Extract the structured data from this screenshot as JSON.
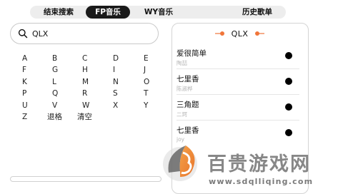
{
  "tabs": [
    {
      "label": "结束搜索"
    },
    {
      "label": "FP音乐",
      "active": true
    },
    {
      "label": "WY音乐"
    },
    {
      "label": "历史歌单"
    }
  ],
  "search": {
    "value": "QLX",
    "icon": "search-icon"
  },
  "keyboard": {
    "rows": [
      [
        "A",
        "B",
        "C",
        "D",
        "E"
      ],
      [
        "F",
        "G",
        "H",
        "I",
        "J"
      ],
      [
        "K",
        "L",
        "M",
        "N",
        "O"
      ],
      [
        "P",
        "Q",
        "R",
        "S",
        "T"
      ],
      [
        "U",
        "V",
        "W",
        "X",
        "Y"
      ],
      [
        "Z",
        "退格",
        "清空"
      ]
    ]
  },
  "panel": {
    "title": "QLX",
    "songs": [
      {
        "title": "爱很简单",
        "artist": "陶喆"
      },
      {
        "title": "七里香",
        "artist": "陈淑桦"
      },
      {
        "title": "三角题",
        "artist": "二珂"
      },
      {
        "title": "七里香",
        "artist": "joy"
      }
    ]
  },
  "watermark": {
    "text": "百贵游戏网",
    "url": "www.sdqlliqing.com"
  },
  "colors": {
    "accent_orange": "#f0753a",
    "active_tab": "#1a1a1a"
  }
}
